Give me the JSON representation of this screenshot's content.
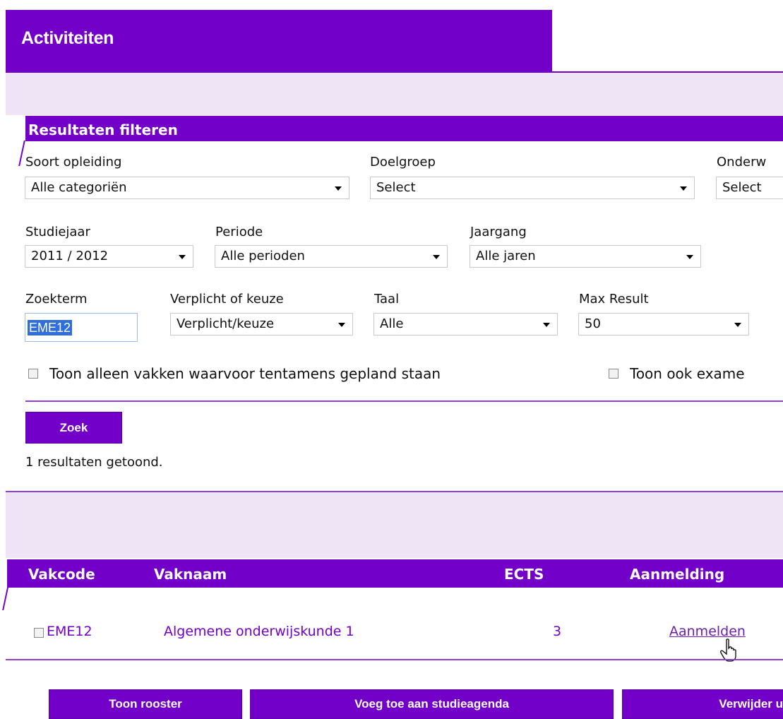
{
  "page": {
    "title": "Activiteiten"
  },
  "filter": {
    "header": "Resultaten filteren",
    "soort_opleiding": {
      "label": "Soort opleiding",
      "value": "Alle categoriën"
    },
    "doelgroep": {
      "label": "Doelgroep",
      "value": "Select"
    },
    "onderwijs": {
      "label": "Onderw",
      "value": "Select"
    },
    "studiejaar": {
      "label": "Studiejaar",
      "value": "2011 / 2012"
    },
    "periode": {
      "label": "Periode",
      "value": "Alle perioden"
    },
    "jaargang": {
      "label": "Jaargang",
      "value": "Alle jaren"
    },
    "zoekterm": {
      "label": "Zoekterm",
      "value": "EME12"
    },
    "verplicht": {
      "label": "Verplicht of keuze",
      "value": "Verplicht/keuze"
    },
    "taal": {
      "label": "Taal",
      "value": "Alle"
    },
    "max_result": {
      "label": "Max Result",
      "value": "50"
    },
    "checkbox_tentamens": "Toon alleen vakken waarvoor tentamens gepland staan",
    "checkbox_examens": "Toon ook exame",
    "search_button": "Zoek",
    "result_count": "1 resultaten getoond."
  },
  "results": {
    "columns": {
      "vakcode": "Vakcode",
      "vaknaam": "Vaknaam",
      "ects": "ECTS",
      "aanmelding": "Aanmelding"
    },
    "rows": [
      {
        "vakcode": "EME12",
        "vaknaam": "Algemene onderwijskunde 1",
        "ects": "3",
        "aanmelding": "Aanmelden"
      }
    ]
  },
  "actions": {
    "toon_rooster": "Toon rooster",
    "voeg_toe": "Voeg toe aan studieagenda",
    "verwijder": "Verwijder u"
  },
  "colors": {
    "accent": "#7300c8",
    "lavender": "#efe4f5",
    "link": "#6a1fb0"
  }
}
